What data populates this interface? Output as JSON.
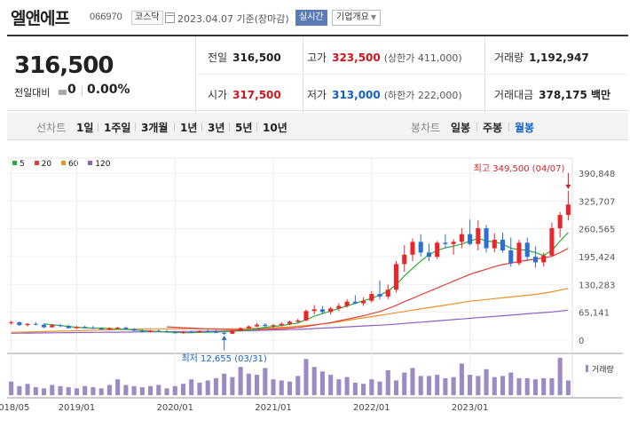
{
  "header": {
    "name": "엘앤에프",
    "code": "066970",
    "market": "코스닥",
    "date": "2023.04.07  기준(장마감)",
    "realtime_label": "실시간",
    "company_label": "기업개요"
  },
  "summary": {
    "price": "316,500",
    "change_label": "전일대비",
    "change_value": "0",
    "change_rate": "0.00%",
    "prev_close_label": "전일",
    "prev_close": "316,500",
    "high_label": "고가",
    "high": "323,500",
    "upper_limit": "(상한가 411,000)",
    "volume_label": "거래량",
    "volume": "1,192,947",
    "open_label": "시가",
    "open": "317,500",
    "low_label": "저가",
    "low": "313,000",
    "lower_limit": "(하한가 222,000)",
    "amount_label": "거래대금",
    "amount": "378,175 백만"
  },
  "tabs": {
    "line_caption": "선차트",
    "line_periods": [
      "1일",
      "1주일",
      "3개월",
      "1년",
      "3년",
      "5년",
      "10년"
    ],
    "candle_caption": "봉차트",
    "candle_periods": [
      "일봉",
      "주봉",
      "월봉"
    ],
    "active_candle": "월봉"
  },
  "legend": [
    {
      "label": "5",
      "color": "#2eaa3a"
    },
    {
      "label": "20",
      "color": "#e0403a"
    },
    {
      "label": "60",
      "color": "#f0902a"
    },
    {
      "label": "120",
      "color": "#9060c0"
    }
  ],
  "chart_data": {
    "type": "candlestick",
    "y_ticks": [
      "390,848",
      "325,707",
      "260,565",
      "195,424",
      "130,283",
      "65,141",
      "0"
    ],
    "y_tick_values": [
      390848,
      325707,
      260565,
      195424,
      130283,
      65141,
      0
    ],
    "x_ticks": [
      "2018/05",
      "2019/01",
      "2020/01",
      "2021/01",
      "2022/01",
      "2023/01"
    ],
    "max_label": "최고 349,500 (04/07)",
    "min_label": "최저 12,655 (03/31)",
    "volume_label": "거래량",
    "candles": [
      [
        40000,
        45000,
        36000,
        42000
      ],
      [
        42000,
        43000,
        33000,
        35000
      ],
      [
        35000,
        40000,
        32000,
        38000
      ],
      [
        38000,
        42000,
        34000,
        36000
      ],
      [
        36000,
        38000,
        28000,
        30000
      ],
      [
        30000,
        38000,
        29000,
        35000
      ],
      [
        35000,
        38000,
        30000,
        33000
      ],
      [
        33000,
        36000,
        27000,
        28000
      ],
      [
        28000,
        33000,
        26000,
        31000
      ],
      [
        31000,
        34000,
        28000,
        29000
      ],
      [
        29000,
        33000,
        26000,
        27000
      ],
      [
        27000,
        30000,
        24000,
        25000
      ],
      [
        25000,
        30000,
        23000,
        28000
      ],
      [
        28000,
        31000,
        26000,
        29000
      ],
      [
        29000,
        32000,
        25000,
        26000
      ],
      [
        26000,
        28000,
        21000,
        22000
      ],
      [
        22000,
        25000,
        18000,
        19000
      ],
      [
        19000,
        24000,
        18000,
        22000
      ],
      [
        22000,
        25000,
        19000,
        20000
      ],
      [
        20000,
        24000,
        17000,
        18000
      ],
      [
        18000,
        21000,
        16000,
        17000
      ],
      [
        17000,
        21000,
        15000,
        19000
      ],
      [
        19000,
        22000,
        17000,
        18000
      ],
      [
        18000,
        23000,
        17000,
        21000
      ],
      [
        21000,
        25000,
        19000,
        20000
      ],
      [
        20000,
        24000,
        16000,
        17000
      ],
      [
        17000,
        20000,
        12655,
        15000
      ],
      [
        15000,
        24000,
        14000,
        22000
      ],
      [
        22000,
        30000,
        20000,
        28000
      ],
      [
        28000,
        34000,
        26000,
        32000
      ],
      [
        32000,
        40000,
        30000,
        36000
      ],
      [
        36000,
        40000,
        31000,
        33000
      ],
      [
        33000,
        38000,
        28000,
        35000
      ],
      [
        35000,
        42000,
        32000,
        38000
      ],
      [
        38000,
        46000,
        35000,
        43000
      ],
      [
        43000,
        50000,
        40000,
        46000
      ],
      [
        46000,
        72000,
        44000,
        68000
      ],
      [
        68000,
        82000,
        60000,
        72000
      ],
      [
        72000,
        80000,
        62000,
        66000
      ],
      [
        66000,
        78000,
        60000,
        74000
      ],
      [
        74000,
        86000,
        68000,
        80000
      ],
      [
        80000,
        96000,
        76000,
        90000
      ],
      [
        90000,
        105000,
        84000,
        86000
      ],
      [
        86000,
        100000,
        80000,
        92000
      ],
      [
        92000,
        115000,
        88000,
        108000
      ],
      [
        108000,
        140000,
        95000,
        102000
      ],
      [
        102000,
        130000,
        96000,
        118000
      ],
      [
        118000,
        185000,
        112000,
        178000
      ],
      [
        178000,
        222000,
        160000,
        200000
      ],
      [
        200000,
        238000,
        185000,
        230000
      ],
      [
        230000,
        248000,
        196000,
        205000
      ],
      [
        205000,
        226000,
        185000,
        195000
      ],
      [
        195000,
        232000,
        190000,
        228000
      ],
      [
        228000,
        248000,
        215000,
        225000
      ],
      [
        225000,
        236000,
        200000,
        230000
      ],
      [
        230000,
        262000,
        215000,
        248000
      ],
      [
        248000,
        282000,
        222000,
        225000
      ],
      [
        225000,
        280000,
        210000,
        262000
      ],
      [
        262000,
        270000,
        205000,
        215000
      ],
      [
        215000,
        250000,
        205000,
        235000
      ],
      [
        235000,
        252000,
        205000,
        210000
      ],
      [
        210000,
        240000,
        172000,
        180000
      ],
      [
        180000,
        235000,
        175000,
        228000
      ],
      [
        228000,
        240000,
        185000,
        195000
      ],
      [
        195000,
        220000,
        170000,
        182000
      ],
      [
        182000,
        205000,
        172000,
        198000
      ],
      [
        198000,
        275000,
        195000,
        262000
      ],
      [
        262000,
        300000,
        240000,
        293000
      ],
      [
        293000,
        349500,
        280000,
        317500
      ]
    ],
    "volumes": [
      12,
      8,
      10,
      7,
      6,
      9,
      8,
      7,
      6,
      8,
      7,
      6,
      9,
      14,
      9,
      8,
      7,
      8,
      9,
      6,
      8,
      10,
      14,
      11,
      13,
      15,
      19,
      16,
      25,
      19,
      18,
      24,
      14,
      13,
      12,
      17,
      32,
      25,
      21,
      18,
      14,
      16,
      11,
      10,
      14,
      12,
      22,
      13,
      20,
      24,
      17,
      17,
      18,
      15,
      16,
      28,
      18,
      17,
      23,
      16,
      17,
      20,
      15,
      15,
      14,
      15,
      15,
      33,
      13
    ],
    "ma5": [
      null,
      null,
      null,
      null,
      38000,
      36000,
      34000,
      32000,
      30000,
      29000,
      28000,
      28000,
      27000,
      26000,
      25000,
      24000,
      22000,
      21000,
      20000,
      19000,
      18000,
      17000,
      17500,
      18000,
      18500,
      19000,
      19500,
      20500,
      22000,
      24000,
      27000,
      30000,
      32000,
      34000,
      37000,
      40000,
      48000,
      56000,
      62000,
      68000,
      74000,
      80000,
      86000,
      92000,
      98000,
      105000,
      115000,
      130000,
      150000,
      168000,
      185000,
      200000,
      210000,
      216000,
      220000,
      225000,
      232000,
      238000,
      232000,
      230000,
      225000,
      215000,
      212000,
      210000,
      205000,
      198000,
      210000,
      232000,
      252000
    ],
    "ma20": [
      null,
      null,
      null,
      null,
      null,
      null,
      null,
      null,
      null,
      null,
      null,
      null,
      null,
      null,
      null,
      null,
      null,
      null,
      null,
      31000,
      30000,
      29000,
      28000,
      27000,
      26500,
      26000,
      25000,
      24500,
      24000,
      24500,
      25000,
      25500,
      26000,
      27000,
      28000,
      29500,
      32000,
      35000,
      38000,
      41000,
      45000,
      49000,
      53000,
      57000,
      62000,
      67000,
      74000,
      81000,
      90000,
      98000,
      106000,
      114000,
      122000,
      130000,
      138000,
      146000,
      154000,
      160000,
      166000,
      172000,
      177000,
      180000,
      184000,
      187000,
      190000,
      192000,
      196000,
      205000,
      215000
    ],
    "ma60": [
      18000,
      18500,
      19000,
      19500,
      20000,
      20500,
      21000,
      21500,
      22000,
      22500,
      23000,
      23500,
      24000,
      24500,
      25000,
      25500,
      26000,
      26500,
      26500,
      26500,
      26500,
      26500,
      26500,
      26500,
      26500,
      26500,
      26500,
      26500,
      26500,
      27000,
      27500,
      28000,
      29000,
      30000,
      31000,
      32500,
      34000,
      36000,
      38000,
      40000,
      43000,
      46000,
      49000,
      52000,
      55000,
      58000,
      61000,
      64000,
      67000,
      70000,
      73000,
      76000,
      79000,
      82000,
      85000,
      88000,
      91000,
      93000,
      95000,
      97000,
      99000,
      101000,
      103000,
      105000,
      107000,
      110000,
      113000,
      117000,
      121000
    ],
    "ma120": [
      16000,
      16200,
      16400,
      16600,
      16800,
      17000,
      17200,
      17400,
      17600,
      17800,
      18000,
      18200,
      18400,
      18600,
      18800,
      19000,
      19200,
      19400,
      19600,
      19800,
      20000,
      20200,
      20400,
      20600,
      20800,
      21000,
      21200,
      21400,
      21600,
      22000,
      22500,
      23000,
      23500,
      24000,
      24500,
      25000,
      26000,
      27000,
      28000,
      29000,
      30000,
      31000,
      32000,
      33000,
      34000,
      35000,
      36000,
      37500,
      39000,
      40500,
      42000,
      43500,
      45000,
      46500,
      48000,
      49500,
      51000,
      52500,
      54000,
      55500,
      57000,
      58500,
      60000,
      61500,
      63000,
      64500,
      66000,
      68000,
      70000
    ]
  }
}
